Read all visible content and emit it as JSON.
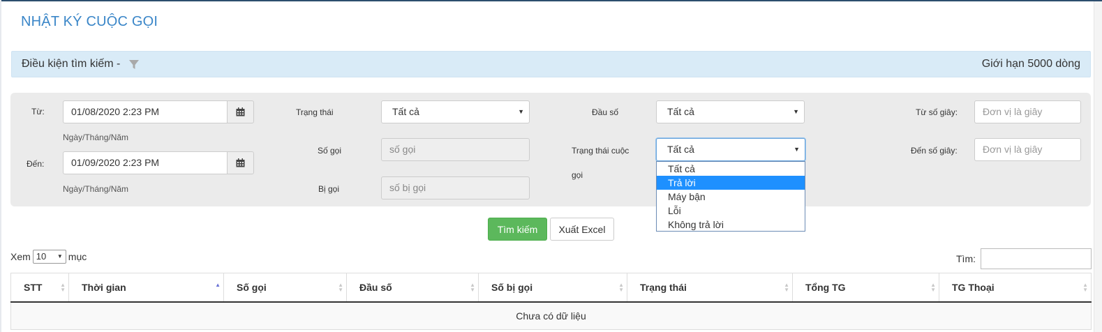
{
  "page": {
    "title": "NHẬT KÝ CUỘC GỌI"
  },
  "search_bar": {
    "label": "Điều kiện tìm kiếm -",
    "filter_icon": "filter-icon",
    "limit": "Giới hạn 5000 dòng"
  },
  "filters": {
    "from_label": "Từ:",
    "from_value": "01/08/2020 2:23 PM",
    "from_hint": "Ngày/Tháng/Năm",
    "to_label": "Đến:",
    "to_value": "01/09/2020 2:23 PM",
    "to_hint": "Ngày/Tháng/Năm",
    "calendar_icon": "calendar-icon",
    "status_label": "Trạng thái",
    "status_value": "Tất cả",
    "caller_label": "Số gọi",
    "caller_placeholder": "số gọi",
    "callee_label": "Bị gọi",
    "callee_placeholder": "số bị gọi",
    "prefix_label": "Đầu số",
    "prefix_value": "Tất cả",
    "call_status_label_1": "Trạng thái cuộc",
    "call_status_label_2": "gọi",
    "call_status_value": "Tất cả",
    "call_status_options": [
      "Tất cả",
      "Trả lời",
      "Máy bận",
      "Lỗi",
      "Không trả lời"
    ],
    "call_status_highlighted": "Trả lời",
    "from_seconds_label": "Từ số giây:",
    "from_seconds_placeholder": "Đơn vị là giây",
    "to_seconds_label": "Đến số giây:",
    "to_seconds_placeholder": "Đơn vị là giây"
  },
  "actions": {
    "search": "Tìm kiếm",
    "export": "Xuất Excel"
  },
  "table_controls": {
    "show_prefix": "Xem",
    "page_size": "10",
    "show_suffix": "mục",
    "search_label": "Tìm:"
  },
  "table": {
    "columns": [
      "STT",
      "Thời gian",
      "Số gọi",
      "Đầu số",
      "Số bị gọi",
      "Trạng thái",
      "Tổng TG",
      "TG Thoại"
    ],
    "sorted_column": "Thời gian",
    "sort_direction": "asc",
    "empty_message": "Chưa có dữ liệu"
  },
  "colors": {
    "title": "#3a86c8",
    "search_bar_bg": "#d9ebf7",
    "primary_button": "#5cb85c",
    "dropdown_highlight": "#1e90ff"
  }
}
